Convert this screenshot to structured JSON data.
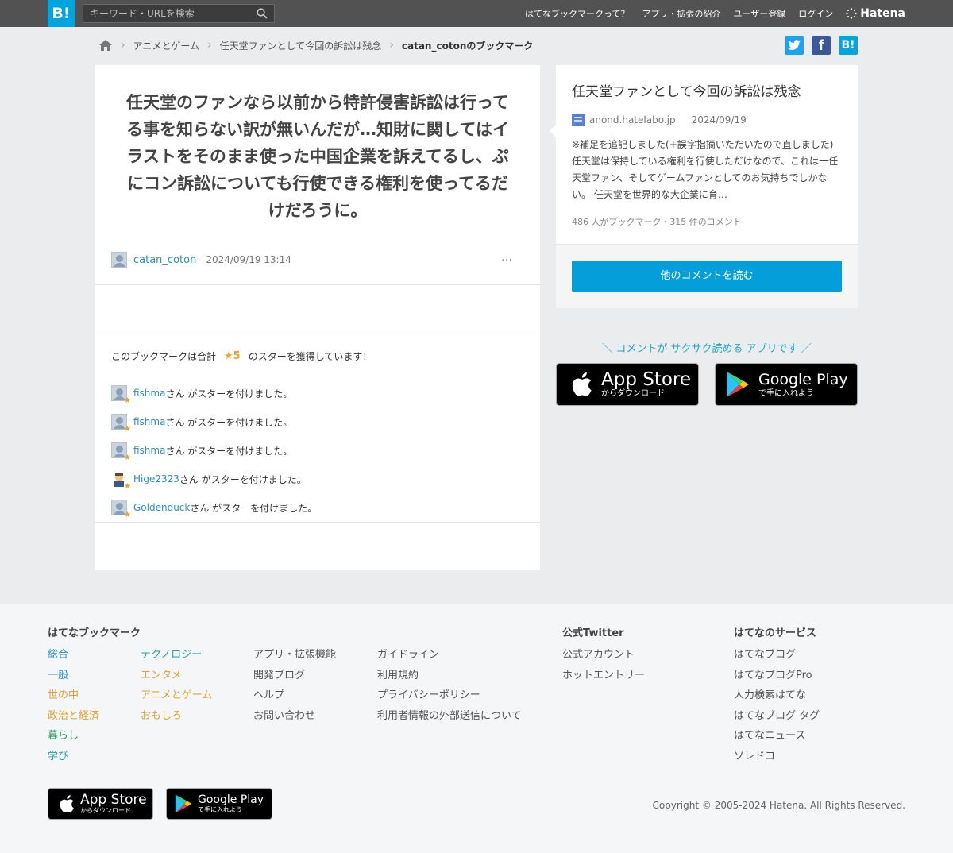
{
  "header": {
    "logo": "B!",
    "search_placeholder": "キーワード・URLを検索",
    "nav": [
      "はてなブックマークって？",
      "アプリ・拡張の紹介",
      "ユーザー登録",
      "ログイン"
    ],
    "brand": "Hatena"
  },
  "breadcrumb": {
    "items": [
      "アニメとゲーム",
      "任天堂ファンとして今回の訴訟は残念"
    ],
    "current": "catan_cotonのブックマーク"
  },
  "share": {
    "hatena": "B!"
  },
  "comment": {
    "text": "任天堂のファンなら以前から特許侵害訴訟は行ってる事を知らない訳が無いんだが…知財に関してはイラストをそのまま使った中国企業を訴えてるし、ぷにコン訴訟についても行使できる権利を使ってるだけだろうに。",
    "user": "catan_coton",
    "date": "2024/09/19 13:14",
    "more": "…"
  },
  "stars": {
    "summary_prefix": "このブックマークは合計",
    "count": "★5",
    "summary_suffix": "のスターを獲得しています！",
    "action_text": "さん がスターを付けました。",
    "givers": [
      "fishma",
      "fishma",
      "fishma",
      "Hige2323",
      "Goldenduck"
    ]
  },
  "entry": {
    "title": "任天堂ファンとして今回の訴訟は残念",
    "domain": "anond.hatelabo.jp",
    "date": "2024/09/19",
    "description": "※補足を追記しました(+誤字指摘いただいたので直しました) 任天堂は保持している権利を行使しただけなので、これは一任天堂ファン、そしてゲームファンとしてのお気持ちでしかない。 任天堂を世界的な大企業に育…",
    "stats": "486 人がブックマーク・315 件のコメント",
    "button": "他のコメントを読む"
  },
  "promo": {
    "text": "＼ コメントが サクサク読める アプリです ／",
    "appstore_big": "App Store",
    "appstore_small": "からダウンロード",
    "googleplay_big": "Google Play",
    "googleplay_small": "で手に入れよう"
  },
  "footer": {
    "col1_heading": "はてなブックマーク",
    "col_categories_a": [
      "総合",
      "一般",
      "世の中",
      "政治と経済",
      "暮らし",
      "学び"
    ],
    "col_categories_b": [
      "テクノロジー",
      "エンタメ",
      "アニメとゲーム",
      "おもしろ"
    ],
    "col_links_a": [
      "アプリ・拡張機能",
      "開発ブログ",
      "ヘルプ",
      "お問い合わせ"
    ],
    "col_links_b": [
      "ガイドライン",
      "利用規約",
      "プライバシーポリシー",
      "利用者情報の外部送信について"
    ],
    "twitter_heading": "公式Twitter",
    "twitter_links": [
      "公式アカウント",
      "ホットエントリー"
    ],
    "services_heading": "はてなのサービス",
    "services": [
      "はてなブログ",
      "はてなブログPro",
      "人力検索はてな",
      "はてなブログ タグ",
      "はてなニュース",
      "ソレドコ"
    ],
    "copyright": "Copyright © 2005-2024 Hatena. All Rights Reserved."
  },
  "colors": {
    "topbar": "#525253",
    "accent": "#00a4de",
    "button": "#049fdb",
    "star": "#e8a72b",
    "link": "#2a8fc4"
  }
}
